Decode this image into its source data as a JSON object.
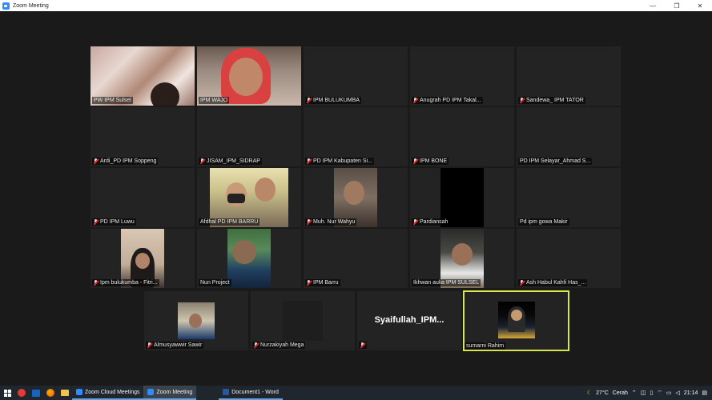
{
  "window": {
    "title": "Zoom Meeting"
  },
  "participants": [
    {
      "name": "PW IPM Sulsel",
      "muted": false
    },
    {
      "name": "IPM WAJO",
      "muted": false
    },
    {
      "name": "IPM BULUKUMBA",
      "muted": true
    },
    {
      "name": "Anugrah PD IPM Takal...",
      "muted": true
    },
    {
      "name": "Sandewa_ IPM TATOR",
      "muted": true
    },
    {
      "name": "Ardi_PD IPM Soppeng",
      "muted": true
    },
    {
      "name": "JISAM_IPM_SIDRAP",
      "muted": true
    },
    {
      "name": "PD IPM Kabupaten Si...",
      "muted": true
    },
    {
      "name": "IPM BONE",
      "muted": true
    },
    {
      "name": "PD IPM Selayar_Ahmad S...",
      "muted": false
    },
    {
      "name": "PD IPM Luwu",
      "muted": true
    },
    {
      "name": "Afdhal PD IPM BARRU",
      "muted": false
    },
    {
      "name": "Muh. Nur Wahyu",
      "muted": true
    },
    {
      "name": "Pardiansah",
      "muted": true
    },
    {
      "name": "Pd ipm gowa Makir",
      "muted": false
    },
    {
      "name": "Ipm bulukumba - Fitri...",
      "muted": true
    },
    {
      "name": "Nun Project",
      "muted": false
    },
    {
      "name": "IPM Barru",
      "muted": true
    },
    {
      "name": "Ikhwan aulia IPM SULSEL",
      "muted": false
    },
    {
      "name": "Ash Habul Kahfi Has_...",
      "muted": true
    },
    {
      "name": "Almusyawwir Sawir",
      "muted": true
    },
    {
      "name": "Nurzakiyah Mega",
      "muted": true
    },
    {
      "name": "Syaifullah_IPM...",
      "muted": true
    },
    {
      "name": "sumarni Rahim",
      "muted": false
    }
  ],
  "taskbar": {
    "apps": [
      {
        "label": "Zoom Cloud Meetings"
      },
      {
        "label": "Zoom Meeting"
      },
      {
        "label": "Document1 - Word"
      }
    ],
    "weather": "27°C",
    "weather_text": "Cerah",
    "time": "21:14"
  },
  "colors": {
    "active_speaker": "#d7e64a",
    "muted_icon": "#e02828",
    "taskbar": "#20262e"
  }
}
